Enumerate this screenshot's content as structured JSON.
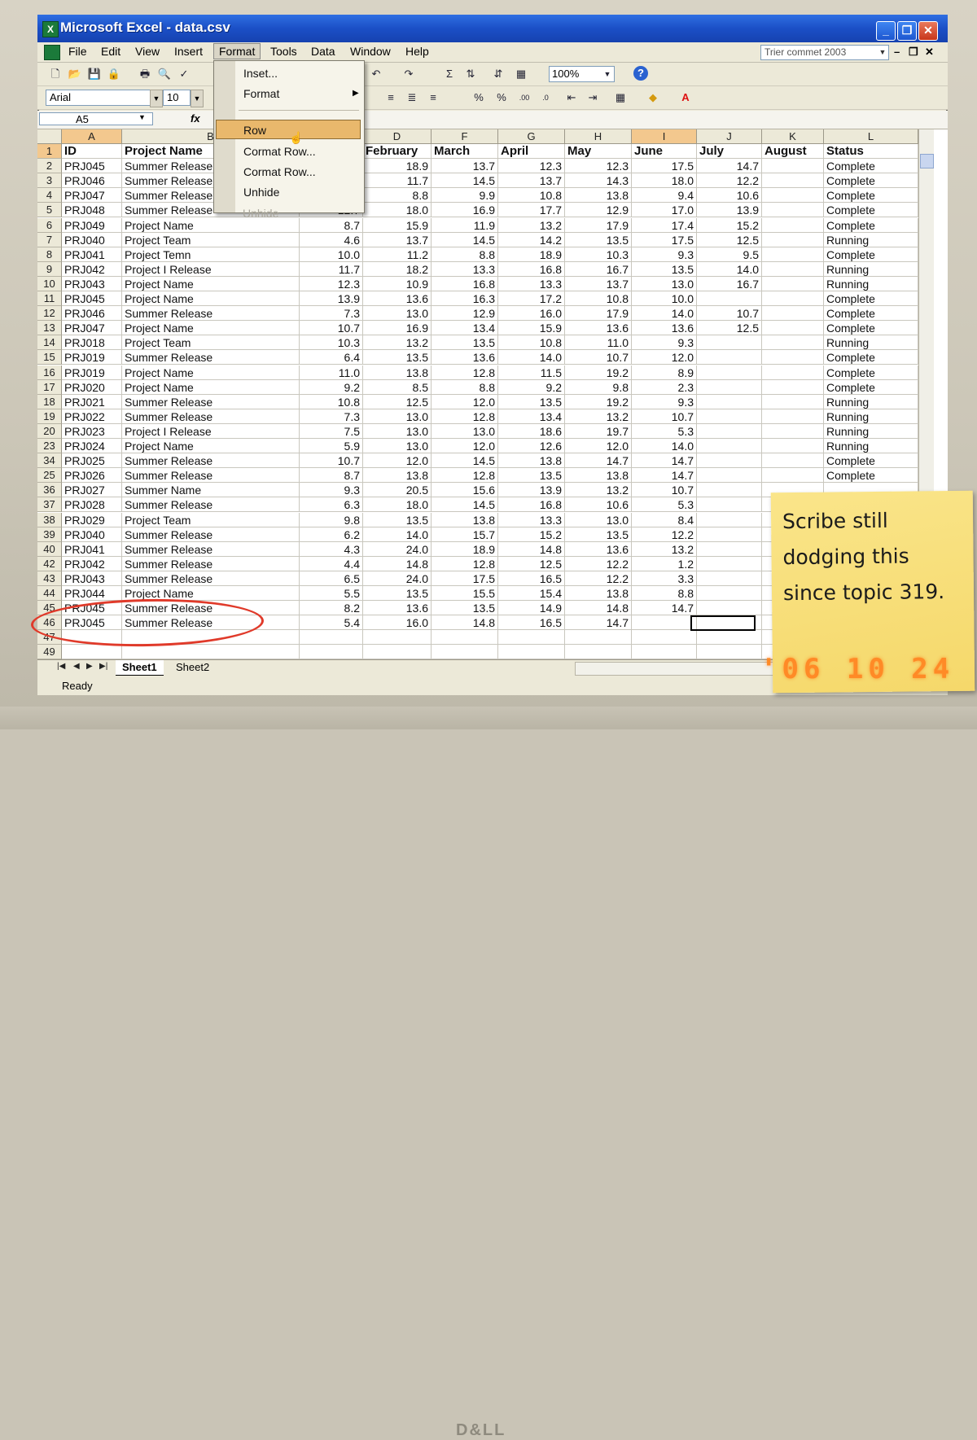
{
  "window": {
    "title": "Microsoft Excel - data.csv",
    "app_icon": "X"
  },
  "menu": {
    "items": [
      "File",
      "Edit",
      "View",
      "Insert",
      "Format",
      "Tools",
      "Data",
      "Window",
      "Help"
    ],
    "active": "Format",
    "ask_box": "Trier commet 2003"
  },
  "toolbar": {
    "zoom": "100%",
    "sigma": "Σ",
    "percent": "%",
    "percent2": "%",
    "dec_inc": ".00",
    "dec_dec": ".0",
    "help": "?"
  },
  "format_toolbar": {
    "font": "Arial",
    "size": "10"
  },
  "formula_bar": {
    "cell_ref": "A5",
    "fx": "fx"
  },
  "dropdown": {
    "items": [
      {
        "label": "Inset...",
        "disabled": false,
        "submenu": false
      },
      {
        "label": "Format",
        "disabled": false,
        "submenu": true
      },
      {
        "label": "Row",
        "disabled": false,
        "submenu": false,
        "highlighted": true
      },
      {
        "label": "Cormat Row...",
        "disabled": false,
        "submenu": false
      },
      {
        "label": "Cormat Row...",
        "disabled": false,
        "submenu": false
      },
      {
        "label": "Unhide",
        "disabled": false,
        "submenu": false
      },
      {
        "label": "Unhide",
        "disabled": true,
        "submenu": false
      }
    ]
  },
  "grid": {
    "columns": [
      "A",
      "B",
      "C",
      "D",
      "F",
      "G",
      "H",
      "I",
      "J",
      "K",
      "L"
    ],
    "header_row": [
      "ID",
      "Project Name",
      "",
      "February",
      "March",
      "April",
      "May",
      "June",
      "July",
      "August",
      "Status"
    ],
    "rows": [
      {
        "n": "2",
        "id": "PRJ045",
        "name": "Summer Release",
        "c": "",
        "d": "18.9",
        "e": "13.7",
        "f": "12.3",
        "g": "12.3",
        "h": "17.5",
        "i": "14.7",
        "status": "Complete"
      },
      {
        "n": "3",
        "id": "PRJ046",
        "name": "Summer Release",
        "c": "",
        "d": "11.7",
        "e": "14.5",
        "f": "13.7",
        "g": "14.3",
        "h": "18.0",
        "i": "12.2",
        "status": "Complete"
      },
      {
        "n": "4",
        "id": "PRJ047",
        "name": "Summer Release",
        "c": "",
        "d": "8.8",
        "e": "9.9",
        "f": "10.8",
        "g": "13.8",
        "h": "9.4",
        "i": "10.6",
        "status": "Complete"
      },
      {
        "n": "5",
        "id": "PRJ048",
        "name": "Summer Release",
        "c": "12.7",
        "d": "18.0",
        "e": "16.9",
        "f": "17.7",
        "g": "12.9",
        "h": "17.0",
        "i": "13.9",
        "status": "Complete"
      },
      {
        "n": "6",
        "id": "PRJ049",
        "name": "Project Name",
        "c": "8.7",
        "d": "15.9",
        "e": "11.9",
        "f": "13.2",
        "g": "17.9",
        "h": "17.4",
        "i": "15.2",
        "status": "Complete"
      },
      {
        "n": "7",
        "id": "PRJ040",
        "name": "Project Team",
        "c": "4.6",
        "d": "13.7",
        "e": "14.5",
        "f": "14.2",
        "g": "13.5",
        "h": "17.5",
        "i": "12.5",
        "status": "Running"
      },
      {
        "n": "8",
        "id": "PRJ041",
        "name": "Project Temn",
        "c": "10.0",
        "d": "11.2",
        "e": "8.8",
        "f": "18.9",
        "g": "10.3",
        "h": "9.3",
        "i": "9.5",
        "status": "Complete"
      },
      {
        "n": "9",
        "id": "PRJ042",
        "name": "Project I Release",
        "c": "11.7",
        "d": "18.2",
        "e": "13.3",
        "f": "16.8",
        "g": "16.7",
        "h": "13.5",
        "i": "14.0",
        "status": "Running"
      },
      {
        "n": "10",
        "id": "PRJ043",
        "name": "Project Name",
        "c": "12.3",
        "d": "10.9",
        "e": "16.8",
        "f": "13.3",
        "g": "13.7",
        "h": "13.0",
        "i": "16.7",
        "status": "Running"
      },
      {
        "n": "11",
        "id": "PRJ045",
        "name": "Project Name",
        "c": "13.9",
        "d": "13.6",
        "e": "16.3",
        "f": "17.2",
        "g": "10.8",
        "h": "10.0",
        "i": "",
        "status": "Complete"
      },
      {
        "n": "12",
        "id": "PRJ046",
        "name": "Summer Release",
        "c": "7.3",
        "d": "13.0",
        "e": "12.9",
        "f": "16.0",
        "g": "17.9",
        "h": "14.0",
        "i": "10.7",
        "status": "Complete"
      },
      {
        "n": "13",
        "id": "PRJ047",
        "name": "Project Name",
        "c": "10.7",
        "d": "16.9",
        "e": "13.4",
        "f": "15.9",
        "g": "13.6",
        "h": "13.6",
        "i": "12.5",
        "status": "Complete"
      },
      {
        "n": "14",
        "id": "PRJ018",
        "name": "Project Team",
        "c": "10.3",
        "d": "13.2",
        "e": "13.5",
        "f": "10.8",
        "g": "11.0",
        "h": "9.3",
        "i": "",
        "status": "Running"
      },
      {
        "n": "15",
        "id": "PRJ019",
        "name": "Summer Release",
        "c": "6.4",
        "d": "13.5",
        "e": "13.6",
        "f": "14.0",
        "g": "10.7",
        "h": "12.0",
        "i": "",
        "status": "Complete"
      },
      {
        "n": "16",
        "id": "PRJ019",
        "name": "Project Name",
        "c": "11.0",
        "d": "13.8",
        "e": "12.8",
        "f": "11.5",
        "g": "19.2",
        "h": "8.9",
        "i": "",
        "status": "Complete"
      },
      {
        "n": "17",
        "id": "PRJ020",
        "name": "Project Name",
        "c": "9.2",
        "d": "8.5",
        "e": "8.8",
        "f": "9.2",
        "g": "9.8",
        "h": "2.3",
        "i": "",
        "status": "Complete"
      },
      {
        "n": "18",
        "id": "PRJ021",
        "name": "Summer Release",
        "c": "10.8",
        "d": "12.5",
        "e": "12.0",
        "f": "13.5",
        "g": "19.2",
        "h": "9.3",
        "i": "",
        "status": "Running"
      },
      {
        "n": "19",
        "id": "PRJ022",
        "name": "Summer Release",
        "c": "7.3",
        "d": "13.0",
        "e": "12.8",
        "f": "13.4",
        "g": "13.2",
        "h": "10.7",
        "i": "",
        "status": "Running"
      },
      {
        "n": "20",
        "id": "PRJ023",
        "name": "Project I Release",
        "c": "7.5",
        "d": "13.0",
        "e": "13.0",
        "f": "18.6",
        "g": "19.7",
        "h": "5.3",
        "i": "",
        "status": "Running"
      },
      {
        "n": "23",
        "id": "PRJ024",
        "name": "Project Name",
        "c": "5.9",
        "d": "13.0",
        "e": "12.0",
        "f": "12.6",
        "g": "12.0",
        "h": "14.0",
        "i": "",
        "status": "Running"
      },
      {
        "n": "34",
        "id": "PRJ025",
        "name": "Summer Release",
        "c": "10.7",
        "d": "12.0",
        "e": "14.5",
        "f": "13.8",
        "g": "14.7",
        "h": "14.7",
        "i": "",
        "status": "Complete"
      },
      {
        "n": "25",
        "id": "PRJ026",
        "name": "Summer Release",
        "c": "8.7",
        "d": "13.8",
        "e": "12.8",
        "f": "13.5",
        "g": "13.8",
        "h": "14.7",
        "i": "",
        "status": "Complete"
      },
      {
        "n": "36",
        "id": "PRJ027",
        "name": "Summer Name",
        "c": "9.3",
        "d": "20.5",
        "e": "15.6",
        "f": "13.9",
        "g": "13.2",
        "h": "10.7",
        "i": "",
        "status": ""
      },
      {
        "n": "37",
        "id": "PRJ028",
        "name": "Summer Release",
        "c": "6.3",
        "d": "18.0",
        "e": "14.5",
        "f": "16.8",
        "g": "10.6",
        "h": "5.3",
        "i": "",
        "status": ""
      },
      {
        "n": "38",
        "id": "PRJ029",
        "name": "Project Team",
        "c": "9.8",
        "d": "13.5",
        "e": "13.8",
        "f": "13.3",
        "g": "13.0",
        "h": "8.4",
        "i": "",
        "status": ""
      },
      {
        "n": "39",
        "id": "PRJ040",
        "name": "Summer Release",
        "c": "6.2",
        "d": "14.0",
        "e": "15.7",
        "f": "15.2",
        "g": "13.5",
        "h": "12.2",
        "i": "",
        "status": ""
      },
      {
        "n": "40",
        "id": "PRJ041",
        "name": "Summer Release",
        "c": "4.3",
        "d": "24.0",
        "e": "18.9",
        "f": "14.8",
        "g": "13.6",
        "h": "13.2",
        "i": "",
        "status": ""
      },
      {
        "n": "42",
        "id": "PRJ042",
        "name": "Summer Release",
        "c": "4.4",
        "d": "14.8",
        "e": "12.8",
        "f": "12.5",
        "g": "12.2",
        "h": "1.2",
        "i": "",
        "status": ""
      },
      {
        "n": "43",
        "id": "PRJ043",
        "name": "Summer Release",
        "c": "6.5",
        "d": "24.0",
        "e": "17.5",
        "f": "16.5",
        "g": "12.2",
        "h": "3.3",
        "i": "",
        "status": ""
      },
      {
        "n": "44",
        "id": "PRJ044",
        "name": "Project Name",
        "c": "5.5",
        "d": "13.5",
        "e": "15.5",
        "f": "15.4",
        "g": "13.8",
        "h": "8.8",
        "i": "",
        "status": ""
      },
      {
        "n": "45",
        "id": "PRJ045",
        "name": "Summer Release",
        "c": "8.2",
        "d": "13.6",
        "e": "13.5",
        "f": "14.9",
        "g": "14.8",
        "h": "14.7",
        "i": "",
        "status": ""
      },
      {
        "n": "46",
        "id": "PRJ045",
        "name": "Summer Release",
        "c": "5.4",
        "d": "16.0",
        "e": "14.8",
        "f": "16.5",
        "g": "14.7",
        "h": "",
        "i": "",
        "status": ""
      },
      {
        "n": "47",
        "id": "",
        "name": "",
        "c": "",
        "d": "",
        "e": "",
        "f": "",
        "g": "",
        "h": "",
        "i": "",
        "status": ""
      },
      {
        "n": "49",
        "id": "",
        "name": "",
        "c": "",
        "d": "",
        "e": "",
        "f": "",
        "g": "",
        "h": "",
        "i": "",
        "status": ""
      }
    ]
  },
  "sheets": {
    "tabs": [
      "Sheet1",
      "Sheet2"
    ],
    "active": "Sheet1"
  },
  "status": {
    "text": "Ready"
  },
  "sticky_note": {
    "text": "Scribe still dodging this since topic 319."
  },
  "date_stamp": "'06 10 24",
  "monitor_brand": "D&LL",
  "colors": {
    "titlebar": "#1b4fc6",
    "selected_header": "#f3c88e",
    "menu_highlight": "#e9b86c",
    "sticky": "#f7dd74",
    "stamp": "#ff8a26",
    "circle": "#e03a2a"
  }
}
